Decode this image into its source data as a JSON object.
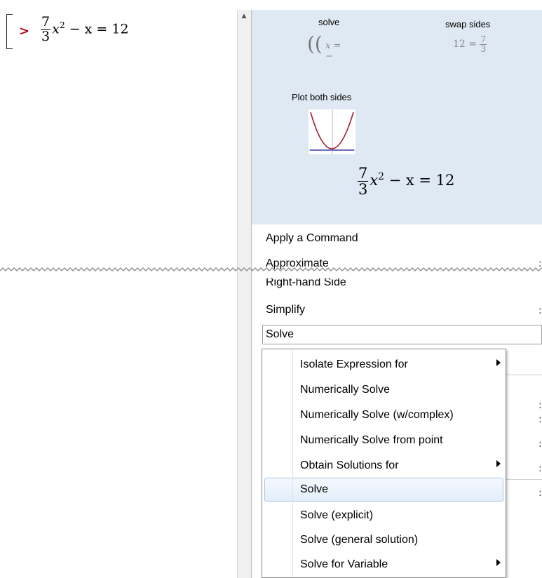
{
  "worksheet": {
    "prompt": ">",
    "input": {
      "numerator": "7",
      "denominator": "3",
      "variable": "x",
      "exponent": "2",
      "rest": "− x = 12"
    }
  },
  "preview": {
    "solve_label": "solve",
    "solve_preview": "x = −",
    "swap_label": "swap sides",
    "swap_preview_left": "12 =",
    "swap_preview_num": "7",
    "swap_preview_den": "3",
    "plot_label": "Plot both sides",
    "expression": {
      "numerator": "7",
      "denominator": "3",
      "variable": "x",
      "exponent": "2",
      "rest": "− x = 12"
    }
  },
  "menu": {
    "apply_command": "Apply a Command",
    "approximate": "Approximate",
    "right_hand_side": "Right-hand Side",
    "simplify": "Simplify",
    "solve": "Solve",
    "colon": ":"
  },
  "submenu": {
    "items": [
      {
        "label": "Isolate Expression for",
        "has_submenu": true
      },
      {
        "label": "Numerically Solve",
        "has_submenu": false
      },
      {
        "label": "Numerically Solve (w/complex)",
        "has_submenu": false
      },
      {
        "label": "Numerically Solve from point",
        "has_submenu": false
      },
      {
        "label": "Obtain Solutions for",
        "has_submenu": true
      },
      {
        "label": "Solve",
        "has_submenu": false,
        "highlighted": true
      },
      {
        "label": "Solve (explicit)",
        "has_submenu": false
      },
      {
        "label": "Solve (general solution)",
        "has_submenu": false
      },
      {
        "label": "Solve for Variable",
        "has_submenu": true
      }
    ]
  },
  "colors": {
    "prompt": "#b8001a",
    "preview_bg": "#dfe9f3",
    "curve": "#a01c2a",
    "line": "#3a3aa6",
    "highlight_border": "#a7c4e3"
  }
}
